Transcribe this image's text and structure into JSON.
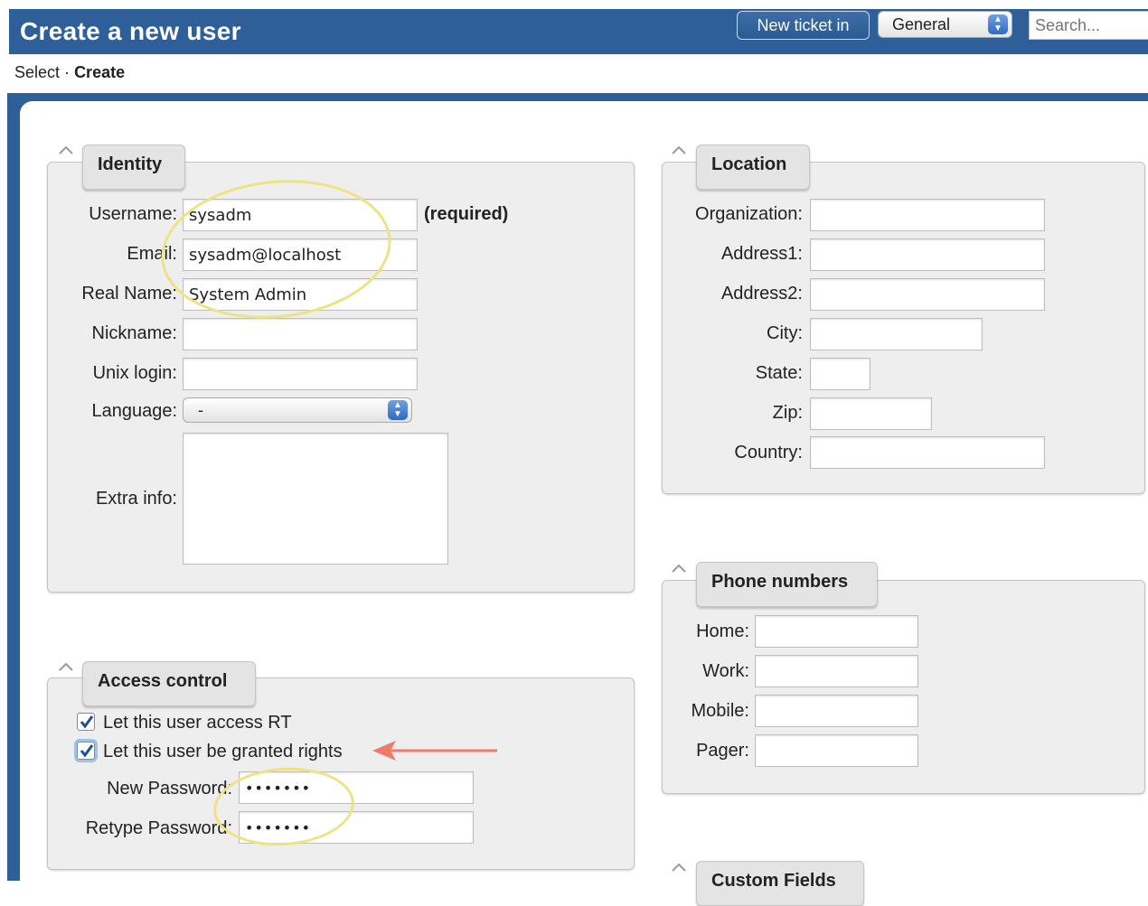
{
  "header": {
    "title": "Create a new user",
    "new_ticket_label": "New ticket in",
    "queue_selected": "General",
    "search_placeholder": "Search..."
  },
  "breadcrumb": {
    "items": [
      "Select",
      "Create"
    ],
    "separator": "·"
  },
  "identity": {
    "title": "Identity",
    "username_label": "Username:",
    "username_value": "sysadm",
    "required_note": "(required)",
    "email_label": "Email:",
    "email_value": "sysadm@localhost",
    "realname_label": "Real Name:",
    "realname_value": "System Admin",
    "nickname_label": "Nickname:",
    "nickname_value": "",
    "unixlogin_label": "Unix login:",
    "unixlogin_value": "",
    "language_label": "Language:",
    "language_value": "-",
    "extrainfo_label": "Extra info:",
    "extrainfo_value": ""
  },
  "location": {
    "title": "Location",
    "organization_label": "Organization:",
    "address1_label": "Address1:",
    "address2_label": "Address2:",
    "city_label": "City:",
    "state_label": "State:",
    "zip_label": "Zip:",
    "country_label": "Country:"
  },
  "phones": {
    "title": "Phone numbers",
    "home_label": "Home:",
    "work_label": "Work:",
    "mobile_label": "Mobile:",
    "pager_label": "Pager:"
  },
  "access": {
    "title": "Access control",
    "access_rt_label": "Let this user access RT",
    "access_rt_checked": true,
    "granted_rights_label": "Let this user be granted rights",
    "granted_rights_checked": true,
    "new_password_label": "New Password:",
    "new_password_value": "•••••••",
    "retype_password_label": "Retype Password:",
    "retype_password_value": "•••••••"
  },
  "custom_fields": {
    "title": "Custom Fields"
  },
  "colors": {
    "header_blue": "#2f5f98",
    "panel_bg": "#eeeeee",
    "annotation_yellow": "#efe283",
    "annotation_arrow": "#ee7a6a"
  }
}
